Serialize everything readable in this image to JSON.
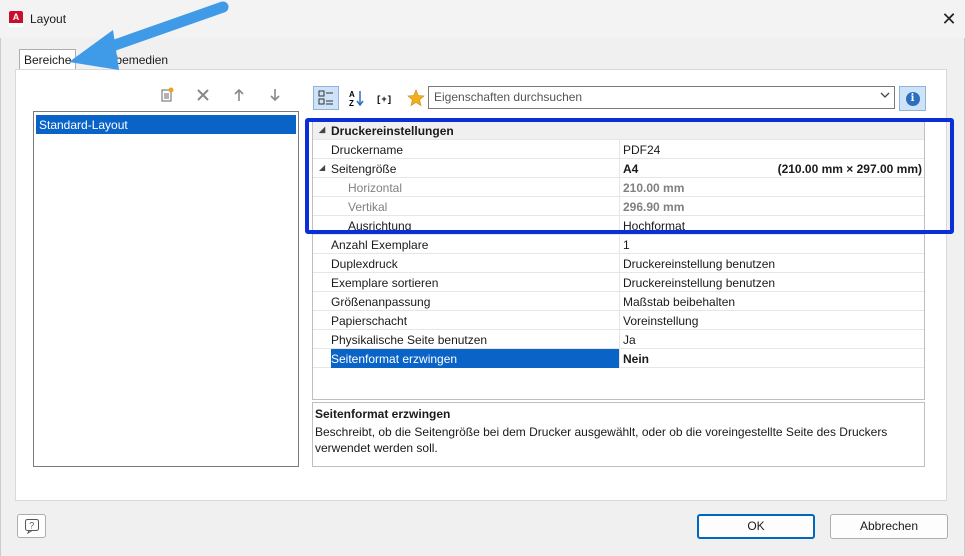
{
  "window": {
    "title": "Layout",
    "app_icon_letter": "A"
  },
  "tabs": [
    {
      "label": "Bereiche",
      "active": true
    },
    {
      "label": "Ausgabemedien",
      "active": false
    }
  ],
  "layouts": [
    {
      "label": "Standard-Layout",
      "selected": true
    }
  ],
  "search": {
    "placeholder": "Eigenschaften durchsuchen"
  },
  "properties": {
    "category": "Druckereinstellungen",
    "rows": [
      {
        "name": "Druckername",
        "value": "PDF24"
      },
      {
        "name": "Seitengröße",
        "value": "A4",
        "extra": "(210.00 mm × 297.00 mm)"
      },
      {
        "name": "Horizontal",
        "value": "210.00 mm"
      },
      {
        "name": "Vertikal",
        "value": "296.90 mm"
      },
      {
        "name": "Ausrichtung",
        "value": "Hochformat"
      },
      {
        "name": "Anzahl Exemplare",
        "value": "1"
      },
      {
        "name": "Duplexdruck",
        "value": "Druckereinstellung benutzen"
      },
      {
        "name": "Exemplare sortieren",
        "value": "Druckereinstellung benutzen"
      },
      {
        "name": "Größenanpassung",
        "value": "Maßstab beibehalten"
      },
      {
        "name": "Papierschacht",
        "value": "Voreinstellung"
      },
      {
        "name": "Physikalische Seite benutzen",
        "value": "Ja"
      },
      {
        "name": "Seitenformat erzwingen",
        "value": "Nein"
      }
    ]
  },
  "description": {
    "title": "Seitenformat erzwingen",
    "text": "Beschreibt, ob die Seitengröße bei dem Drucker ausgewählt, oder ob die voreingestellte Seite des Druckers verwendet werden soll."
  },
  "buttons": {
    "ok": "OK",
    "cancel": "Abbrechen"
  },
  "colors": {
    "selection": "#0a64c8",
    "highlight_box": "#0a2fd6",
    "arrow": "#3f9ae8"
  }
}
